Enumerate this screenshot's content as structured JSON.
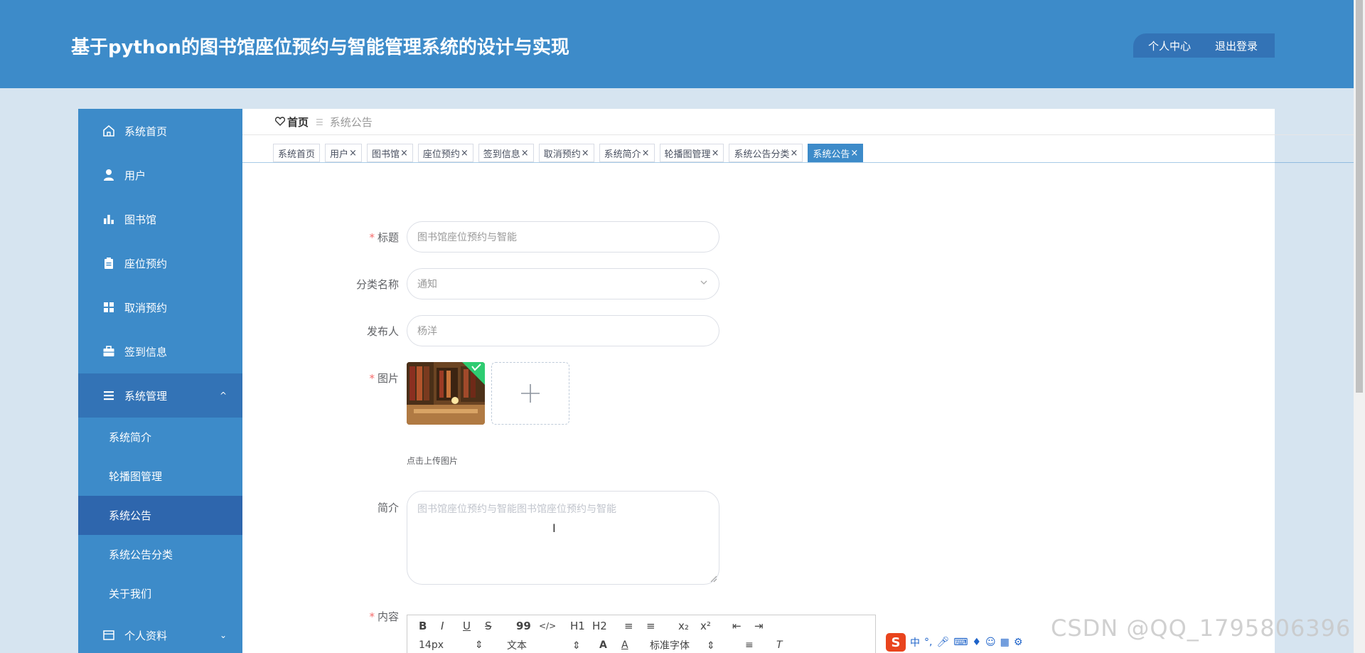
{
  "header": {
    "title": "基于python的图书馆座位预约与智能管理系统的设计与实现",
    "personal_center": "个人中心",
    "logout": "退出登录"
  },
  "sidebar": {
    "items": [
      {
        "label": "系统首页",
        "icon": "home-icon"
      },
      {
        "label": "用户",
        "icon": "user-icon"
      },
      {
        "label": "图书馆",
        "icon": "bar-chart-icon"
      },
      {
        "label": "座位预约",
        "icon": "clipboard-icon"
      },
      {
        "label": "取消预约",
        "icon": "grid-icon"
      },
      {
        "label": "签到信息",
        "icon": "briefcase-icon"
      },
      {
        "label": "系统管理",
        "icon": "menu-icon",
        "arrow": "^"
      }
    ],
    "sub_items": [
      "系统简介",
      "轮播图管理",
      "系统公告",
      "系统公告分类",
      "关于我们"
    ],
    "personal": {
      "label": "个人资料",
      "icon": "window-icon",
      "arrow": "⌄"
    }
  },
  "breadcrumb": {
    "home": "首页",
    "current": "系统公告"
  },
  "tabs": [
    {
      "label": "系统首页",
      "closable": false
    },
    {
      "label": "用户",
      "closable": true
    },
    {
      "label": "图书馆",
      "closable": true
    },
    {
      "label": "座位预约",
      "closable": true
    },
    {
      "label": "签到信息",
      "closable": true
    },
    {
      "label": "取消预约",
      "closable": true
    },
    {
      "label": "系统简介",
      "closable": true
    },
    {
      "label": "轮播图管理",
      "closable": true
    },
    {
      "label": "系统公告分类",
      "closable": true
    },
    {
      "label": "系统公告",
      "closable": true,
      "active": true
    }
  ],
  "form": {
    "title_label": "标题",
    "title_value": "图书馆座位预约与智能",
    "category_label": "分类名称",
    "category_value": "通知",
    "publisher_label": "发布人",
    "publisher_value": "杨洋",
    "image_label": "图片",
    "upload_tip": "点击上传图片",
    "intro_label": "简介",
    "intro_value": "图书馆座位预约与智能图书馆座位预约与智能",
    "content_label": "内容"
  },
  "editor": {
    "row1": [
      "B",
      "I",
      "U",
      "S",
      "99",
      "</>",
      "H1",
      "H2",
      "≡",
      "≡",
      "x₂",
      "x²",
      "⇤",
      "⇥"
    ],
    "font_size": "14px",
    "text_type": "文本",
    "font_family": "标准字体"
  },
  "ime": {
    "logo": "S",
    "mode": "中",
    "punct": "°,"
  },
  "watermark": "CSDN @QQ_1795806396",
  "colors": {
    "primary": "#3d8bc9",
    "primary_dark": "#3373b6",
    "active": "#2e66ad",
    "required": "#f56c6c"
  }
}
